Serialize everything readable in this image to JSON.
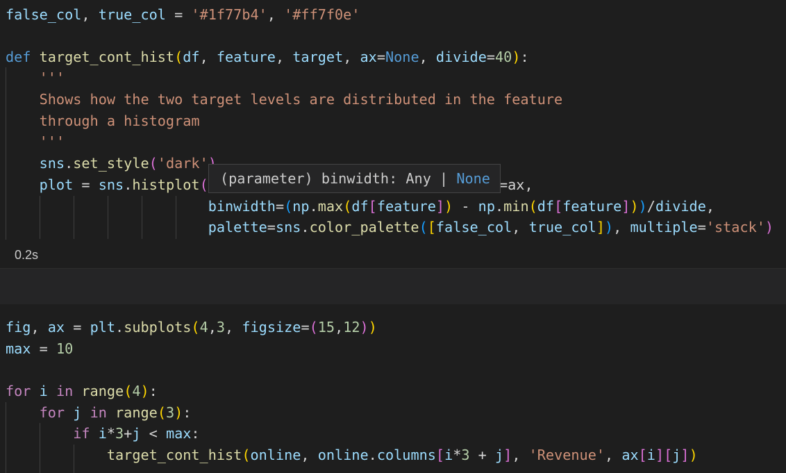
{
  "cell1": {
    "lines": [
      "false_col, true_col = '#1f77b4', '#ff7f0e'",
      "",
      "def target_cont_hist(df, feature, target, ax=None, divide=40):",
      "    '''",
      "    Shows how the two target levels are distributed in the feature",
      "    through a histogram",
      "    '''",
      "    sns.set_style('dark')",
      "    plot = sns.histplot(",
      "                        binwidth=(np.max(df[feature]) - np.min(df[feature]))/divide,",
      "                        palette=sns.color_palette([false_col, true_col]), multiple='stack')"
    ],
    "hidden_tail": "=ax,",
    "exec_time": "0.2s"
  },
  "tooltip": {
    "prefix": "(parameter) binwidth: Any | ",
    "none_text": "None"
  },
  "cell2": {
    "lines": [
      "fig, ax = plt.subplots(4,3, figsize=(15,12))",
      "max = 10",
      "",
      "for i in range(4):",
      "    for j in range(3):",
      "        if i*3+j < max:",
      "            target_cont_hist(online, online.columns[i*3 + j], 'Revenue', ax[i][j])"
    ]
  },
  "colors": {
    "background": "#1e1e1e",
    "keyword": "#569cd6",
    "control": "#c586c0",
    "function": "#dcdcaa",
    "string": "#ce9178",
    "number": "#b5cea8",
    "variable": "#9cdcfe"
  }
}
